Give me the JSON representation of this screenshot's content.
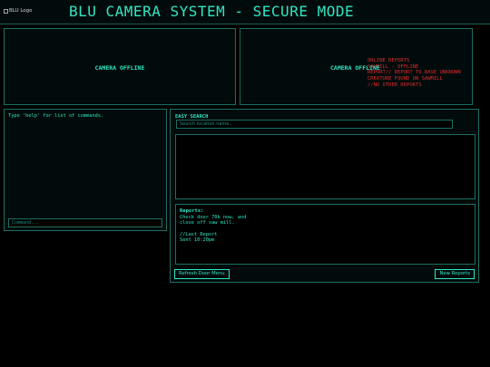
{
  "header": {
    "logo_alt": "BLU Logo",
    "title": "BLU CAMERA SYSTEM - SECURE MODE"
  },
  "cameras": [
    {
      "status": "CAMERA OFFLINE"
    },
    {
      "status": "CAMERA OFFLINE"
    }
  ],
  "camera_overlay": {
    "lines": [
      "ONLINE REPORTS",
      "SAWMILL - OFFLINE",
      "REPORT// REPORT TO BASE UNKNOWN",
      "CREATURE FOUND ON SAWMILL",
      "//NO OTHER REPORTS"
    ]
  },
  "console": {
    "hint": "Type 'help' for list of commands.",
    "input_placeholder": "Command..."
  },
  "search": {
    "label": "EASY SEARCH",
    "placeholder": "Search location name.."
  },
  "reports": {
    "title": "Reports:",
    "body": "Check door 70b now, and\nclose off saw mill.\n\n//Last Report\nSent 10:20pm"
  },
  "buttons": {
    "refresh": "Refresh Door Menu",
    "new_reports": "New Reports"
  },
  "colors": {
    "accent": "#2fe6c4",
    "border": "#1d6e63",
    "alert": "#e02a2a",
    "background": "#000000"
  }
}
